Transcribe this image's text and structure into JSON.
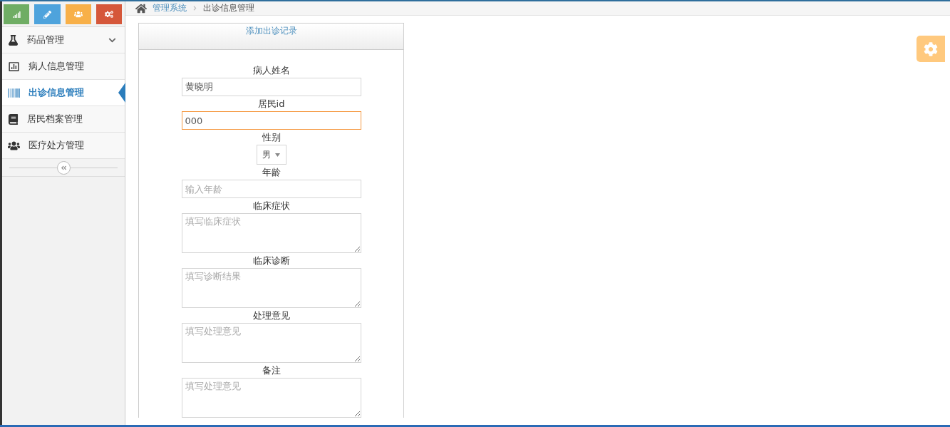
{
  "shortcuts": [
    {
      "kind": "chart",
      "color": "#6fad64"
    },
    {
      "kind": "pencil",
      "color": "#4ea3dc"
    },
    {
      "kind": "users",
      "color": "#f8b049"
    },
    {
      "kind": "cogs",
      "color": "#d5573a"
    }
  ],
  "sidebar": {
    "items": [
      {
        "kind": "flask",
        "label": "药品管理",
        "expanded": false,
        "selected": false
      },
      {
        "kind": "chart",
        "label": "病人信息管理",
        "selected": false
      },
      {
        "kind": "barcode",
        "label": "出诊信息管理",
        "selected": true
      },
      {
        "kind": "book",
        "label": "居民档案管理",
        "selected": false
      },
      {
        "kind": "users",
        "label": "医疗处方管理",
        "selected": false
      }
    ]
  },
  "breadcrumb": {
    "link": "管理系统",
    "current": "出诊信息管理"
  },
  "form": {
    "title": "添加出诊记录",
    "fields": [
      {
        "kind": "input",
        "label": "病人姓名",
        "value": "黄晓明",
        "focused": false
      },
      {
        "kind": "input",
        "label": "居民id",
        "value": "000",
        "focused": true
      },
      {
        "kind": "select",
        "label": "性别",
        "value": "男"
      },
      {
        "kind": "input",
        "label": "年龄",
        "placeholder": "输入年龄",
        "focused": false
      },
      {
        "kind": "textarea",
        "label": "临床症状",
        "placeholder": "填写临床症状"
      },
      {
        "kind": "textarea",
        "label": "临床诊断",
        "placeholder": "填写诊断结果"
      },
      {
        "kind": "textarea",
        "label": "处理意见",
        "placeholder": "填写处理意见"
      },
      {
        "kind": "textarea",
        "label": "备注",
        "placeholder": "填写处理意见"
      }
    ]
  }
}
